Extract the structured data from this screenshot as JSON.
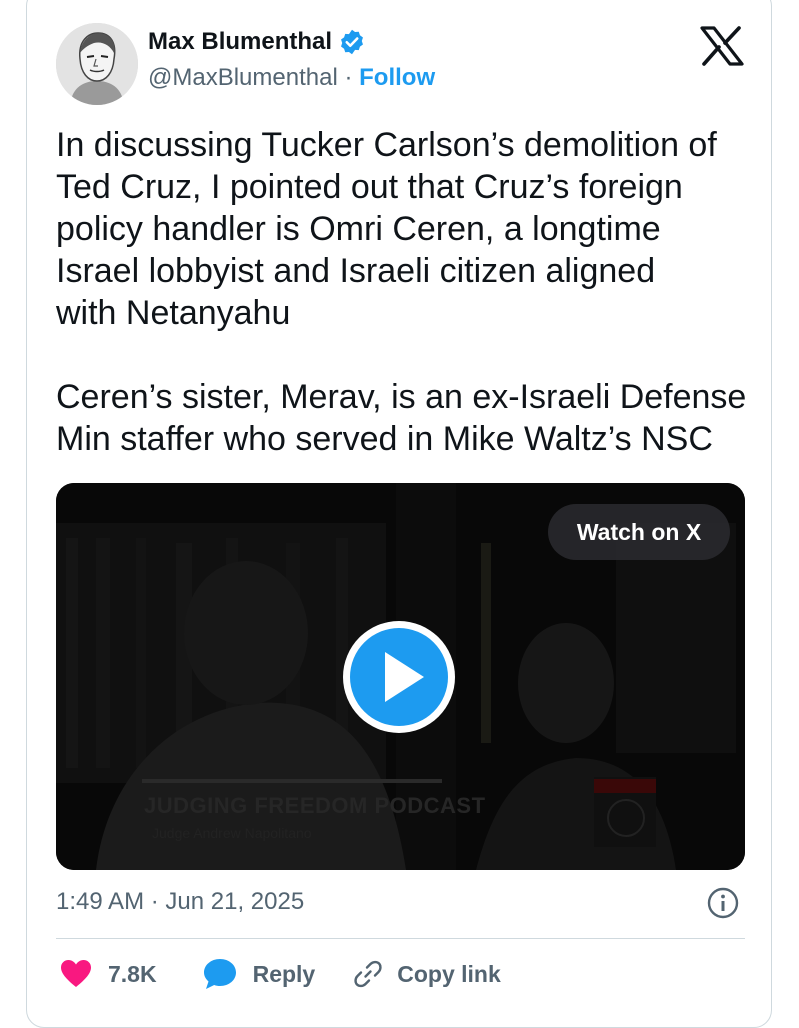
{
  "author": {
    "name": "Max Blumenthal",
    "handle": "@MaxBlumenthal",
    "separator": "·",
    "follow_label": "Follow"
  },
  "brand_logo_icon": "x-logo-icon",
  "tweet": {
    "paragraphs": [
      "In discussing Tucker Carlson’s demolition of\nTed Cruz, I pointed out that Cruz’s foreign\npolicy handler is Omri Ceren, a longtime\nIsrael lobbyist and Israeli citizen aligned\nwith Netanyahu",
      "Ceren’s sister, Merav, is an ex-Israeli Defense\nMin staffer who served in Mike Waltz’s NSC"
    ]
  },
  "video": {
    "watch_label": "Watch on X",
    "show_title": "JUDGING FREEDOM PODCAST",
    "host_line": "Judge Andrew Napolitano",
    "play_icon": "play-icon"
  },
  "timestamp": "1:49 AM · Jun 21, 2025",
  "actions": {
    "like_count": "7.8K",
    "reply_label": "Reply",
    "copy_link_label": "Copy link"
  },
  "colors": {
    "accent": "#1d9bf0",
    "like": "#f91880",
    "muted_text": "#536471",
    "border": "#cfd9de"
  }
}
